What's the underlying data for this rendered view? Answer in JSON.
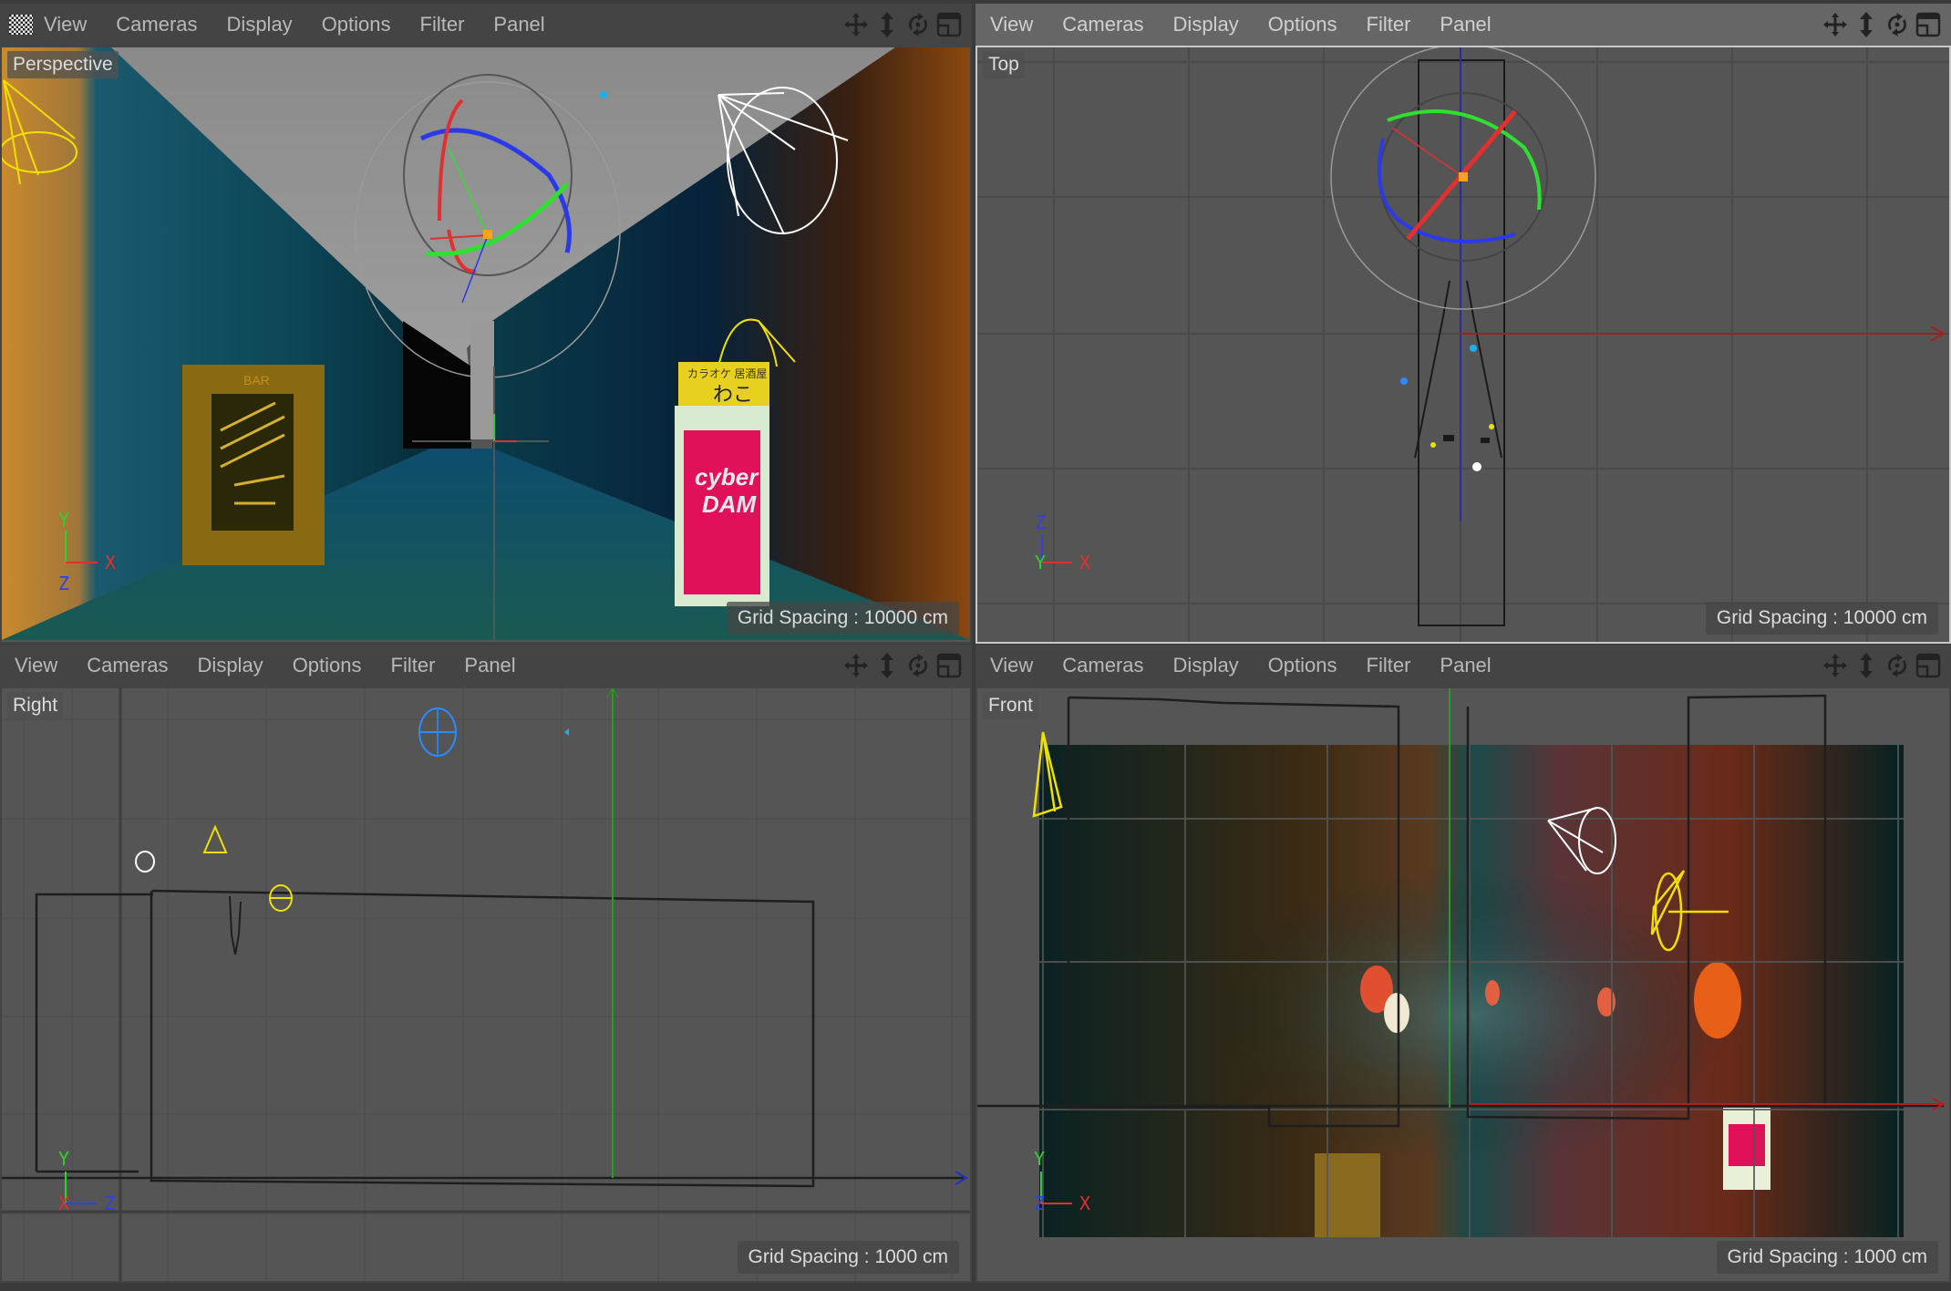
{
  "menu": [
    "View",
    "Cameras",
    "Display",
    "Options",
    "Filter",
    "Panel"
  ],
  "toolbar_icons": [
    "move-view-icon",
    "zoom-view-icon",
    "rotate-view-icon",
    "toggle-layout-icon"
  ],
  "viewports": {
    "perspective": {
      "label": "Perspective",
      "grid_spacing": "Grid Spacing : 10000 cm",
      "axes": [
        "Y",
        "X",
        "Z"
      ]
    },
    "top": {
      "label": "Top",
      "grid_spacing": "Grid Spacing : 10000 cm",
      "axes": [
        "Z",
        "Y",
        "X"
      ],
      "active": true
    },
    "right": {
      "label": "Right",
      "grid_spacing": "Grid Spacing : 1000 cm",
      "axes": [
        "Y",
        "X",
        "Z"
      ]
    },
    "front": {
      "label": "Front",
      "grid_spacing": "Grid Spacing : 1000 cm",
      "axes": [
        "Y",
        "Z",
        "X"
      ]
    }
  },
  "scene_text": {
    "sign_top_small": "カラオケ 居酒屋",
    "sign_top_big": "わこ",
    "sign_brand_1": "cyber",
    "sign_brand_2": "DAM",
    "menu_board_header": "BAR"
  },
  "colors": {
    "axis_x": "#e03030",
    "axis_y": "#30d030",
    "axis_z": "#3040e0",
    "light_yellow": "#f0e000",
    "light_white": "#ffffff",
    "selection_blue": "#2a8cff",
    "viewport_bg": "#555555",
    "header_bg": "#444444",
    "active_header_bg": "#666666"
  }
}
